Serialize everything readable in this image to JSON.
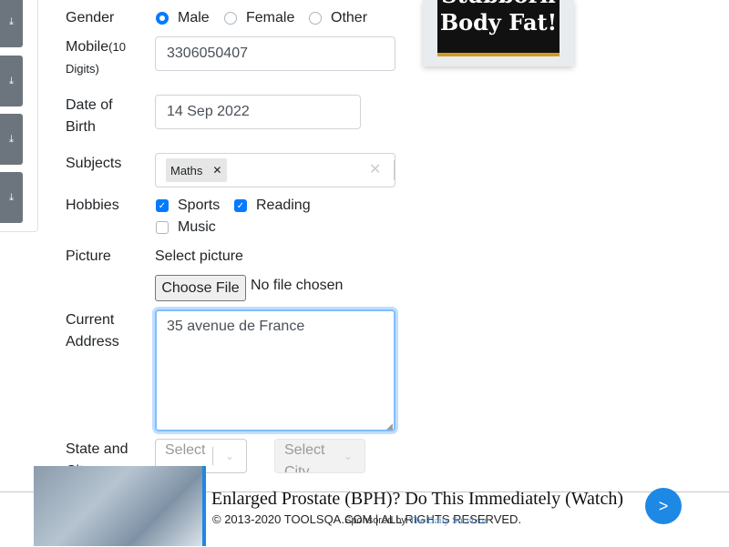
{
  "sidebar": {
    "buttons": [
      {
        "icon": "download-icon"
      },
      {
        "icon": "download-icon"
      },
      {
        "icon": "download-icon"
      },
      {
        "icon": "download-icon"
      }
    ]
  },
  "form": {
    "gender": {
      "label": "Gender",
      "options": [
        "Male",
        "Female",
        "Other"
      ],
      "selected": "Male"
    },
    "mobile": {
      "label": "Mobile",
      "hint": "(10 Digits)",
      "value": "3306050407"
    },
    "dob": {
      "label": "Date of Birth",
      "value": "14 Sep 2022"
    },
    "subjects": {
      "label": "Subjects",
      "chips": [
        "Maths"
      ]
    },
    "hobbies": {
      "label": "Hobbies",
      "options": [
        {
          "label": "Sports",
          "checked": true
        },
        {
          "label": "Reading",
          "checked": true
        },
        {
          "label": "Music",
          "checked": false
        }
      ]
    },
    "picture": {
      "label": "Picture",
      "prompt": "Select picture",
      "button": "Choose File",
      "status": "No file chosen"
    },
    "address": {
      "label": "Current Address",
      "value": "35 avenue de France"
    },
    "state_city": {
      "label": "State and City",
      "state_placeholder": "Select State",
      "city_placeholder": "Select City"
    }
  },
  "ad_card": {
    "text": "Stubborn Body Fat!",
    "accent": "#d19b22"
  },
  "footer": {
    "copyright": "© 2013-2020 TOOLSQA.COM | ALL RIGHTS RESERVED.",
    "ad_title": "Enlarged Prostate (BPH)? Do This Immediately (Watch)",
    "sponsor_prefix": "Sponsored by",
    "sponsor_name": "The Daily Survivor",
    "next": ">"
  },
  "colors": {
    "primary": "#007bff",
    "focus": "#80bdff"
  }
}
